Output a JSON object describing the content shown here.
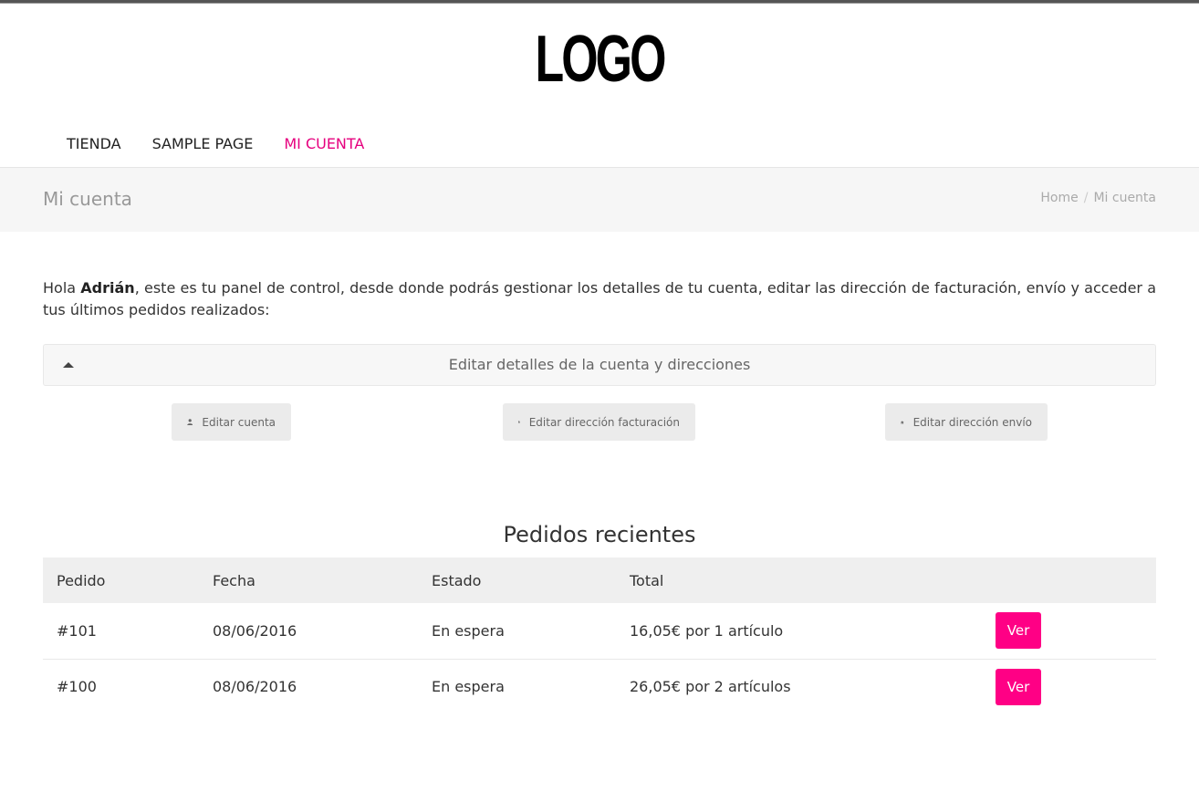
{
  "site": {
    "logo_text": "LOGO",
    "nav": [
      {
        "label": "TIENDA",
        "active": false
      },
      {
        "label": "SAMPLE PAGE",
        "active": false
      },
      {
        "label": "MI CUENTA",
        "active": true
      }
    ],
    "accent_color": "#ff0085"
  },
  "page": {
    "title": "Mi cuenta",
    "breadcrumb": [
      "Home",
      "Mi cuenta"
    ],
    "breadcrumb_separator": "/"
  },
  "intro": {
    "prefix": "Hola ",
    "user_name": "Adrián",
    "suffix": ", este es tu panel de control, desde donde podrás gestionar los detalles de tu cuenta, editar las dirección de facturación, envío y acceder a tus últimos pedidos realizados:"
  },
  "accordion": {
    "label": "Editar detalles de la cuenta y direcciones",
    "expanded": true
  },
  "actions": [
    {
      "label": "Editar cuenta",
      "icon": "user-icon"
    },
    {
      "label": "Editar dirección facturación",
      "icon": "document-icon"
    },
    {
      "label": "Editar dirección envío",
      "icon": "home-icon"
    }
  ],
  "orders": {
    "title": "Pedidos recientes",
    "columns": [
      "Pedido",
      "Fecha",
      "Estado",
      "Total"
    ],
    "rows": [
      {
        "id": "#101",
        "date": "08/06/2016",
        "status": "En espera",
        "total": "16,05€ por 1 artículo",
        "action": "Ver"
      },
      {
        "id": "#100",
        "date": "08/06/2016",
        "status": "En espera",
        "total": "26,05€ por 2 artículos",
        "action": "Ver"
      }
    ]
  }
}
